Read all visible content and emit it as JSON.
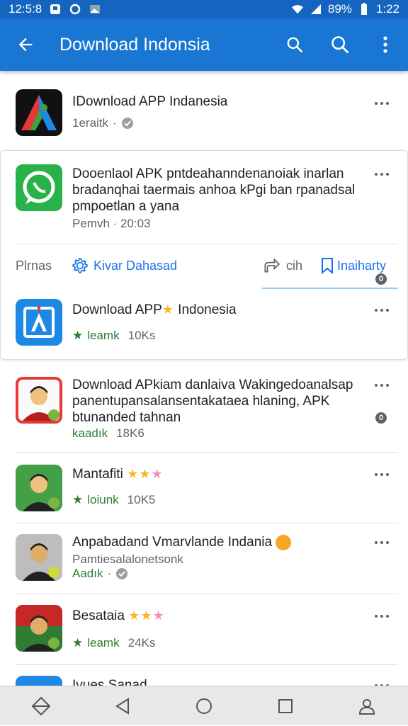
{
  "status": {
    "time": "12:5:8",
    "battery": "89%",
    "clock": "1:22"
  },
  "appbar": {
    "title": "Download Indonsia"
  },
  "items": [
    {
      "name": "IDownload APP Indanesia",
      "meta": "1eraitk"
    },
    {
      "name": "Dooenlaol APK pntdeahanndenanoiak inarlan bradanqhai taermais anhoa kPgi ban rpanadsal pmpoetlan a yana",
      "meta": "Pemvh · 20:03"
    },
    {
      "name": "Download APP",
      "name_suffix": "Indonesia",
      "meta": "leamk",
      "count": "10Ks"
    },
    {
      "name": "Download APkiam danlaiva Wakingedoanalsap panentupansalansentakataea hlaning, APK btunanded tahnan",
      "meta": "kaadık",
      "count": "18K6"
    },
    {
      "name": "Mantafiti",
      "meta": "loiunk",
      "count": "10K5"
    },
    {
      "name": "Anpabadand Vmarvlande Indania",
      "sub": "Pamtiesalalonetsonk",
      "meta": "Aadık"
    },
    {
      "name": "Besataia",
      "meta": "leamk",
      "count": "24Ks"
    },
    {
      "name": "Ivues Sanad"
    }
  ],
  "card_actions": {
    "left": "Plrnas",
    "kivar": "Kivar Dahasad",
    "share": "cih",
    "bookmark": "Inaiharty"
  },
  "badges": {
    "zero": "0"
  },
  "colors": {
    "primary": "#1976d2",
    "statusbar": "#1565c0",
    "green": "#2e7d32",
    "link": "#1a73e8"
  }
}
